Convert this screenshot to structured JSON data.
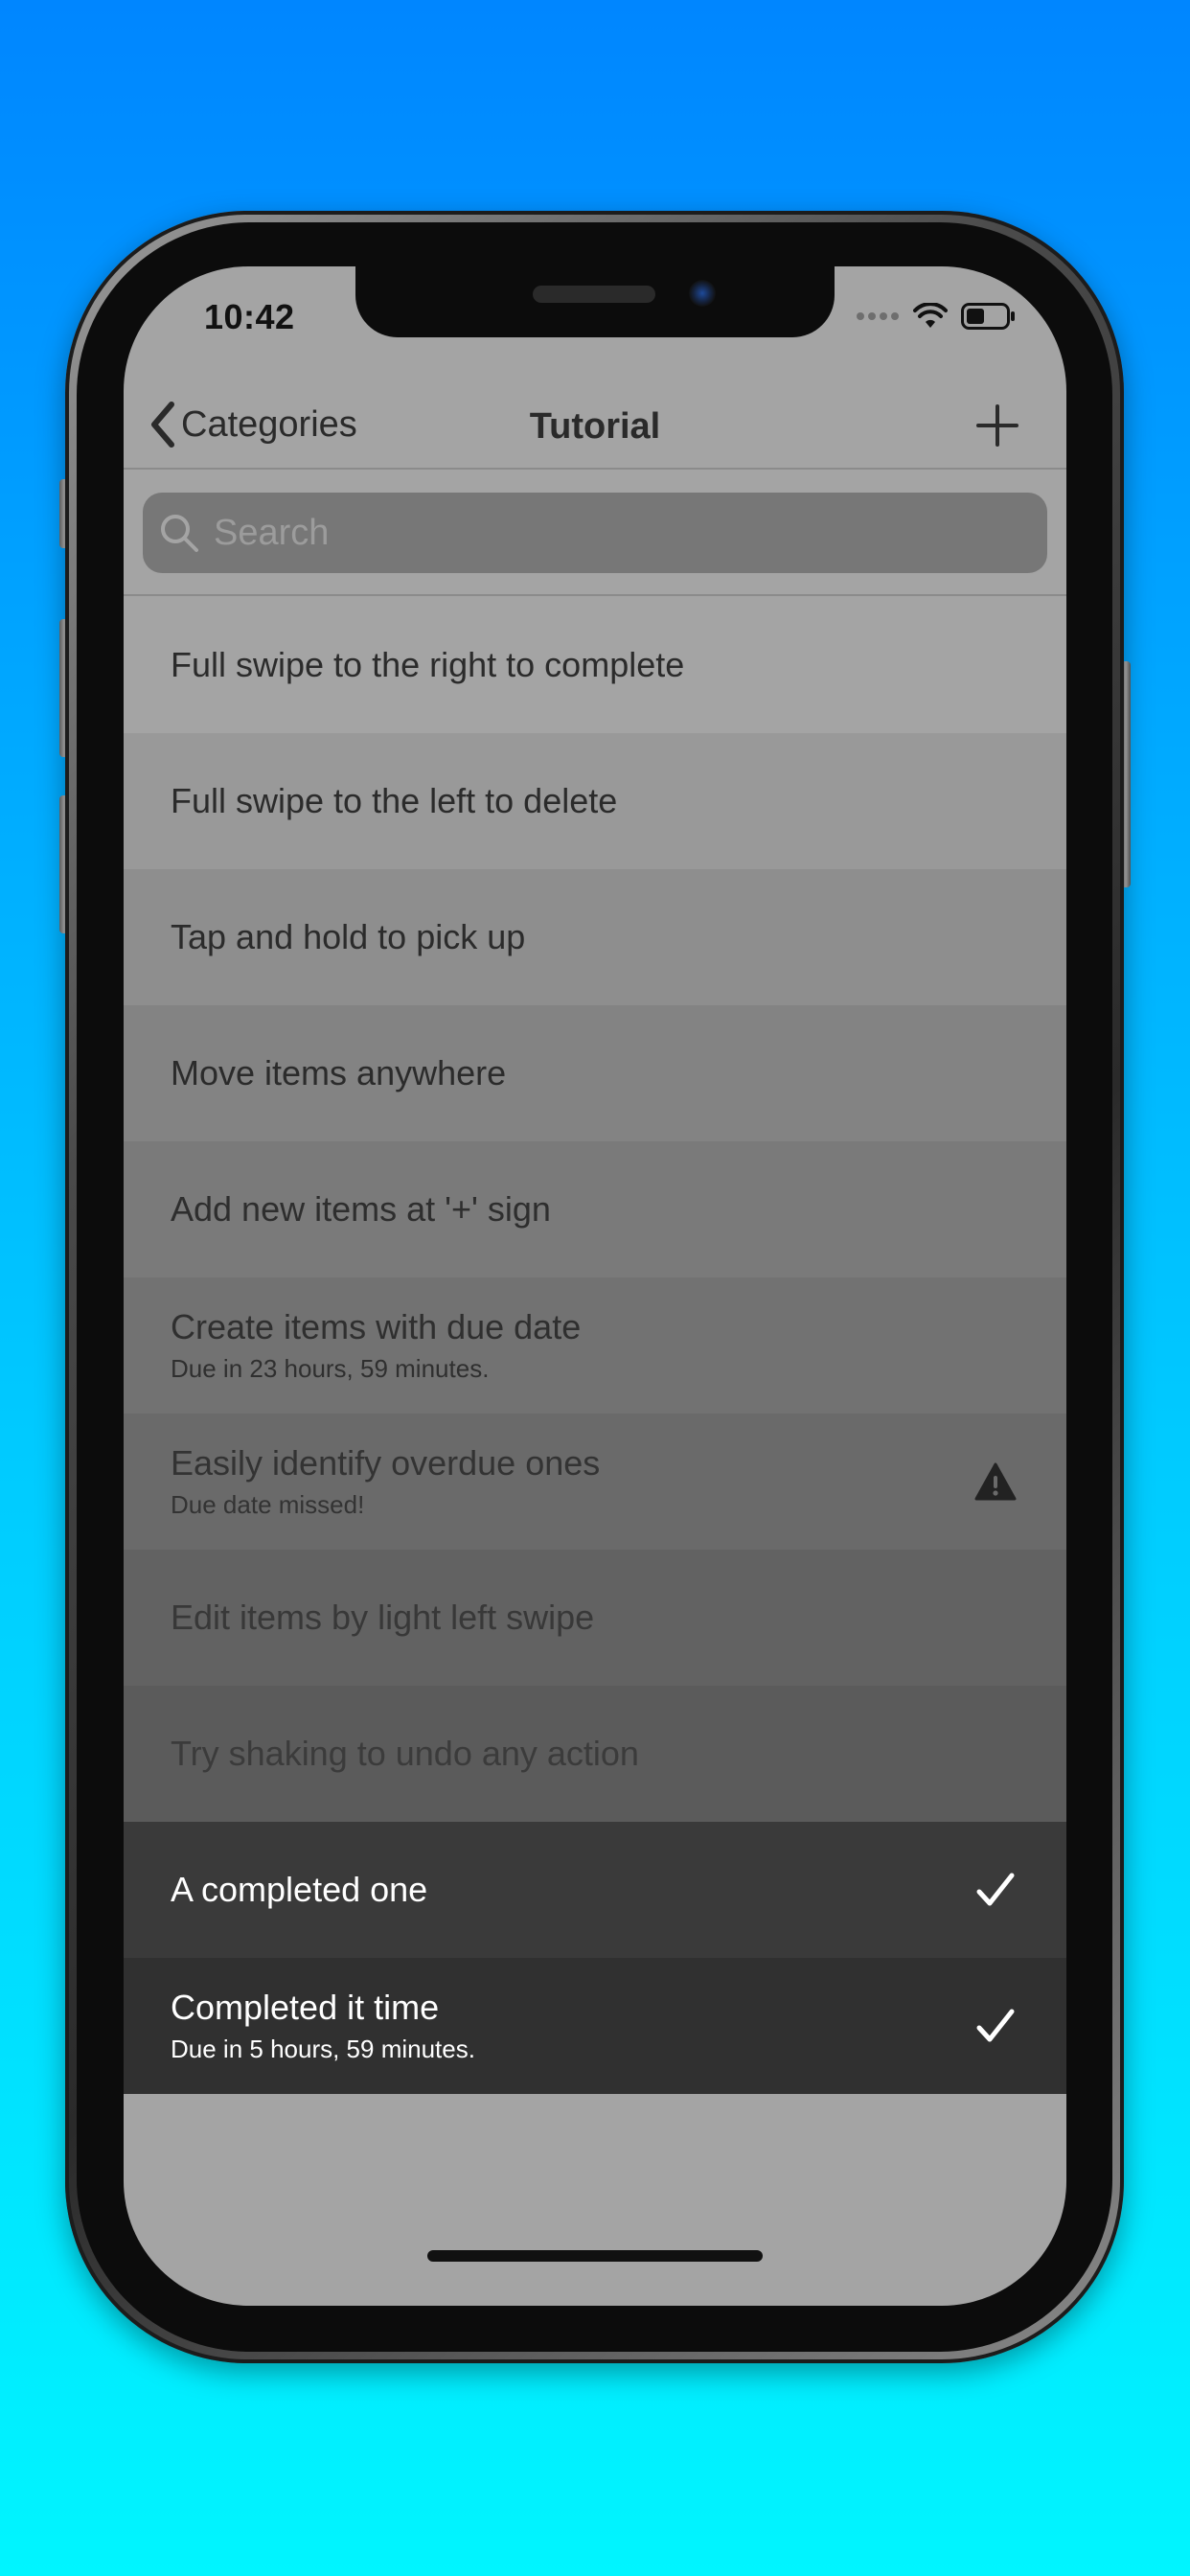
{
  "status_bar": {
    "time": "10:42"
  },
  "nav": {
    "back_label": "Categories",
    "title": "Tutorial",
    "add_icon": "plus-icon"
  },
  "search": {
    "placeholder": "Search",
    "value": ""
  },
  "items": [
    {
      "title": "Full swipe to the right to complete",
      "subtitle": "",
      "background": "#a4a4a4",
      "text_color": "#2b2b2b",
      "accessory": ""
    },
    {
      "title": "Full swipe to the left to delete",
      "subtitle": "",
      "background": "#999999",
      "text_color": "#2b2b2b",
      "accessory": ""
    },
    {
      "title": "Tap and hold to pick up",
      "subtitle": "",
      "background": "#8e8e8e",
      "text_color": "#2b2b2b",
      "accessory": ""
    },
    {
      "title": "Move items anywhere",
      "subtitle": "",
      "background": "#838383",
      "text_color": "#2b2b2b",
      "accessory": ""
    },
    {
      "title": "Add new items at '+' sign",
      "subtitle": "",
      "background": "#7a7a7a",
      "text_color": "#2e2e2e",
      "accessory": ""
    },
    {
      "title": "Create items with due date",
      "subtitle": "Due in 23 hours, 59 minutes.",
      "background": "#727272",
      "text_color": "#2f2f2f",
      "accessory": ""
    },
    {
      "title": "Easily identify overdue ones",
      "subtitle": "Due date missed!",
      "background": "#6a6a6a",
      "text_color": "#333333",
      "accessory": "warning-icon"
    },
    {
      "title": "Edit items by light left swipe",
      "subtitle": "",
      "background": "#626262",
      "text_color": "#383838",
      "accessory": ""
    },
    {
      "title": "Try shaking to undo any action",
      "subtitle": "",
      "background": "#5b5b5b",
      "text_color": "#3b3b3b",
      "accessory": ""
    },
    {
      "title": "A completed one",
      "subtitle": "",
      "background": "#3a3a3a",
      "text_color": "#ffffff",
      "accessory": "checkmark-icon"
    },
    {
      "title": "Completed it time",
      "subtitle": "Due in 5 hours, 59 minutes.",
      "background": "#303030",
      "text_color": "#ffffff",
      "accessory": "checkmark-icon"
    }
  ],
  "colors": {
    "screen_background": "#a4a4a4",
    "search_background": "#777777",
    "gradient_top": "#0086ff",
    "gradient_bottom": "#00f5ff"
  }
}
